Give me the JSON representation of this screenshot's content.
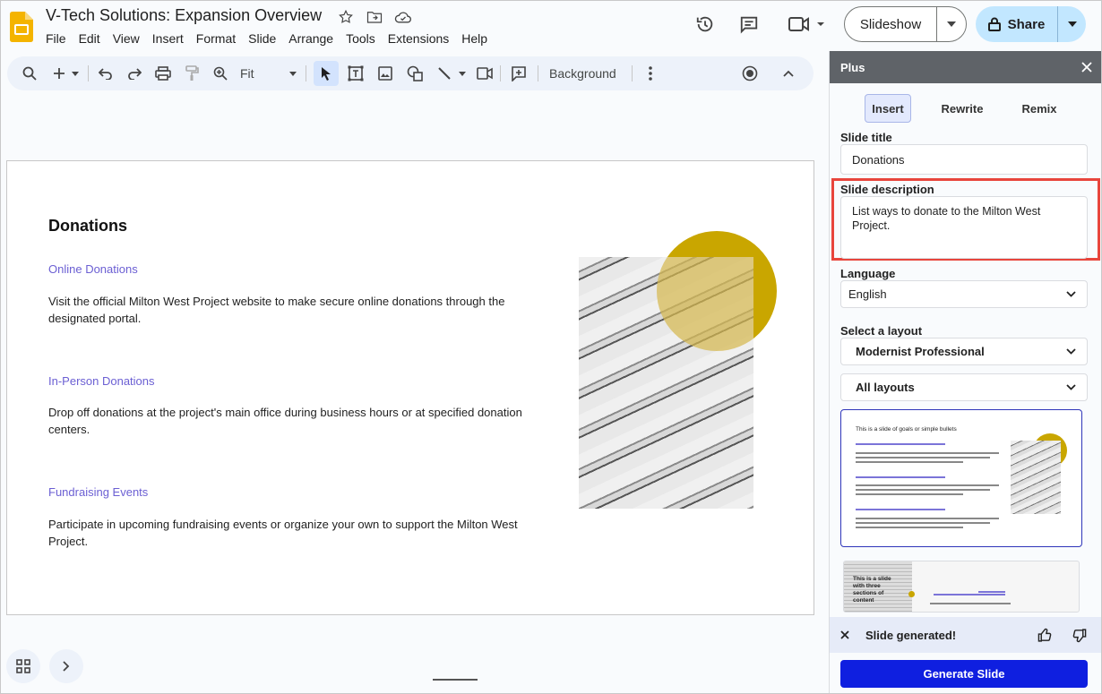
{
  "header": {
    "doc_title": "V-Tech Solutions: Expansion Overview",
    "menu": [
      "File",
      "Edit",
      "View",
      "Insert",
      "Format",
      "Slide",
      "Arrange",
      "Tools",
      "Extensions",
      "Help"
    ],
    "slideshow_label": "Slideshow",
    "share_label": "Share"
  },
  "toolbar": {
    "zoom_value": "Fit",
    "background_label": "Background"
  },
  "slide": {
    "title": "Donations",
    "sections": [
      {
        "heading": "Online Donations",
        "body": "Visit the official Milton West Project website to make secure online donations through the designated portal."
      },
      {
        "heading": "In-Person Donations",
        "body": "Drop off donations at the project's main office during business hours or at specified donation centers."
      },
      {
        "heading": "Fundraising Events",
        "body": "Participate in upcoming fundraising events or organize your own to support the Milton West Project."
      }
    ]
  },
  "panel": {
    "title": "Plus",
    "tabs": [
      "Insert",
      "Rewrite",
      "Remix"
    ],
    "active_tab": "Insert",
    "slide_title_label": "Slide title",
    "slide_title_value": "Donations",
    "slide_desc_label": "Slide description",
    "slide_desc_value": "List ways to donate to the Milton West Project.",
    "language_label": "Language",
    "language_value": "English",
    "layout_label": "Select a layout",
    "layout_value": "Modernist Professional",
    "layout_filter": "All layouts",
    "thumb1_title": "This is a slide of goals or simple bullets",
    "thumb2_title": "This is a slide with three sections of content",
    "status_text": "Slide generated!",
    "generate_label": "Generate Slide"
  },
  "colors": {
    "accent_blue": "#0f1fe0",
    "highlight_red": "#e8453c",
    "heading_purple": "#6b5fd3",
    "circle_gold": "#c9a600"
  }
}
